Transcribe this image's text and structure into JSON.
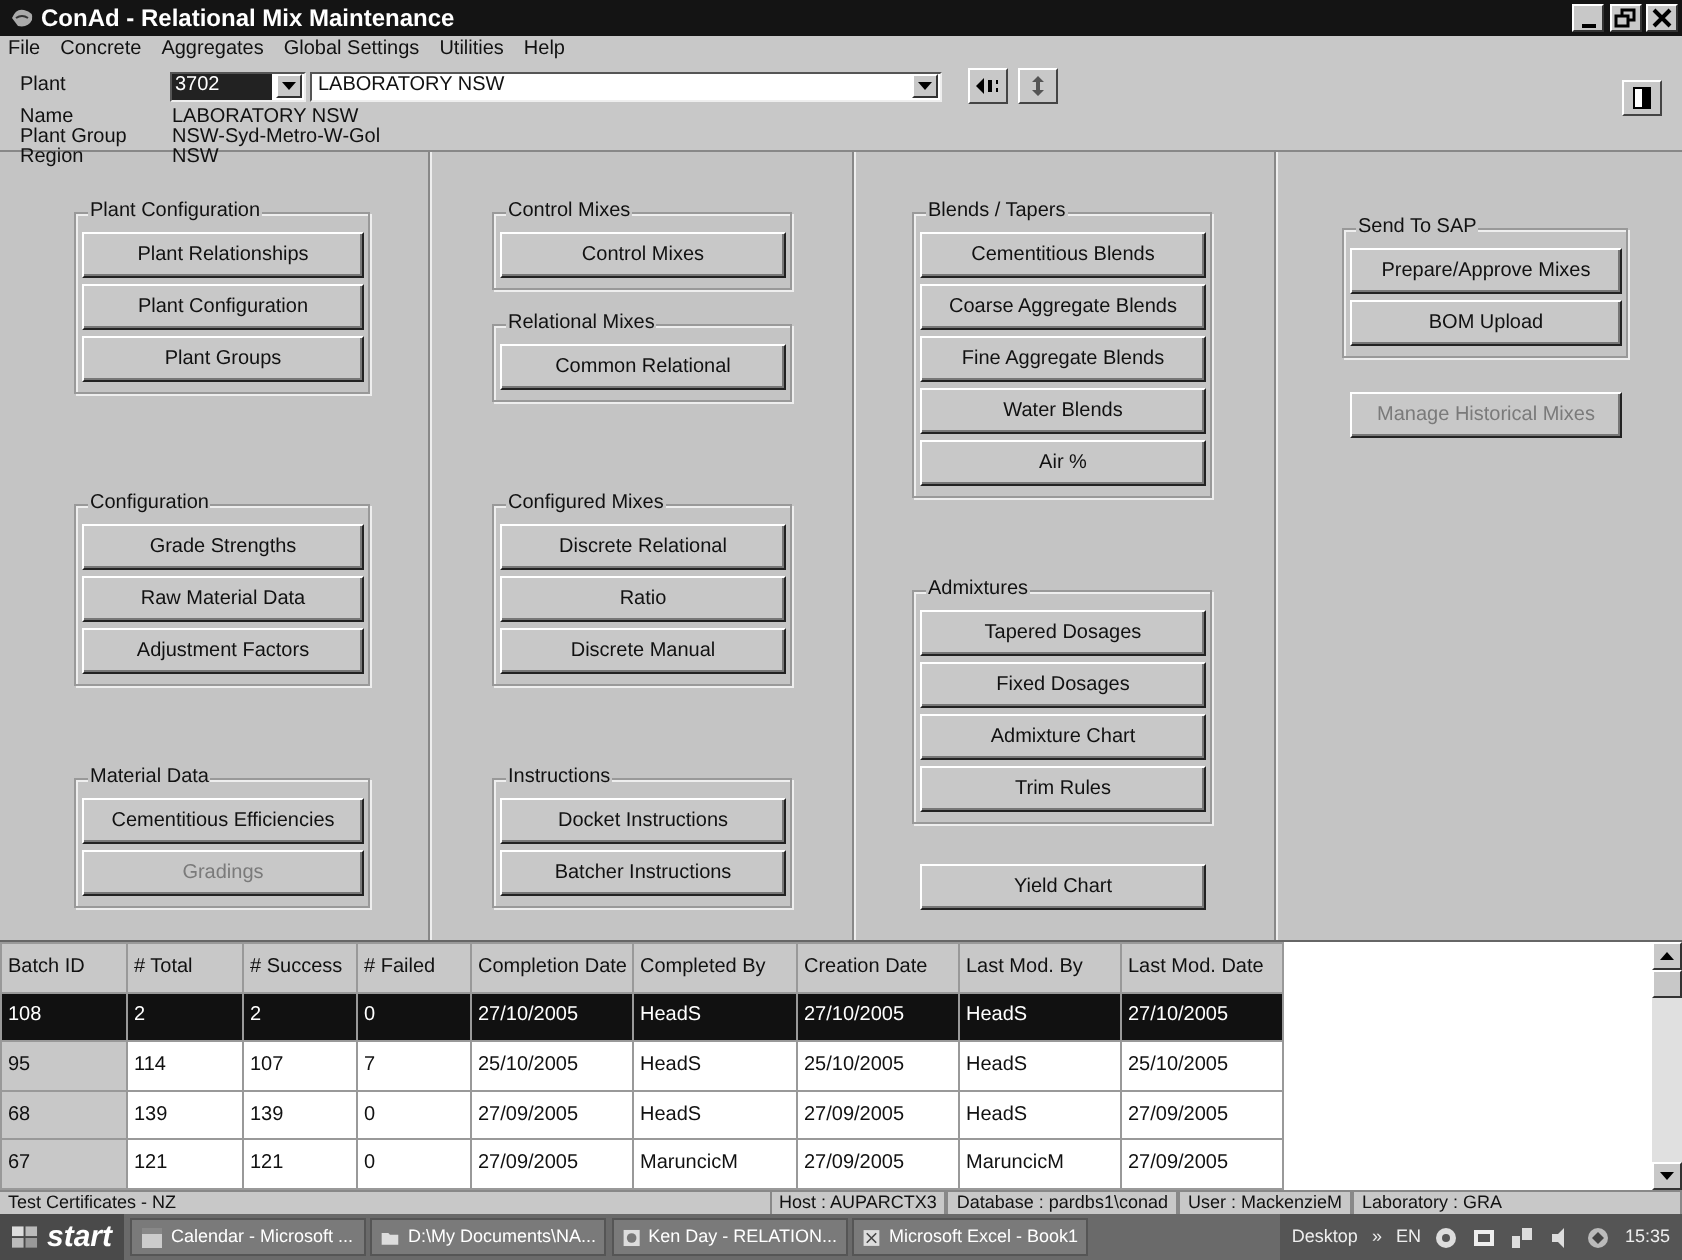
{
  "window": {
    "title": "ConAd - Relational Mix Maintenance"
  },
  "menu": [
    "File",
    "Concrete",
    "Aggregates",
    "Global Settings",
    "Utilities",
    "Help"
  ],
  "plant": {
    "label": "Plant",
    "code": "3702",
    "name_select": "LABORATORY NSW",
    "info": [
      {
        "label": "Name",
        "value": "LABORATORY NSW"
      },
      {
        "label": "Plant Group",
        "value": "NSW-Syd-Metro-W-Gol"
      },
      {
        "label": "Region",
        "value": "NSW"
      }
    ]
  },
  "columns": [
    {
      "items": [
        {
          "kind": "group",
          "title": "Plant Configuration",
          "buttons": [
            {
              "label": "Plant Relationships",
              "disabled": false
            },
            {
              "label": "Plant Configuration",
              "disabled": false
            },
            {
              "label": "Plant Groups",
              "disabled": false
            }
          ]
        },
        {
          "kind": "group",
          "title": "Configuration",
          "buttons": [
            {
              "label": "Grade Strengths",
              "disabled": false
            },
            {
              "label": "Raw Material Data",
              "disabled": false
            },
            {
              "label": "Adjustment Factors",
              "disabled": false
            }
          ]
        },
        {
          "kind": "group",
          "title": "Material Data",
          "buttons": [
            {
              "label": "Cementitious Efficiencies",
              "disabled": false
            },
            {
              "label": "Gradings",
              "disabled": true
            }
          ]
        }
      ]
    },
    {
      "items": [
        {
          "kind": "group",
          "title": "Control Mixes",
          "buttons": [
            {
              "label": "Control Mixes",
              "disabled": false
            }
          ]
        },
        {
          "kind": "group",
          "title": "Relational Mixes",
          "buttons": [
            {
              "label": "Common Relational",
              "disabled": false
            }
          ]
        },
        {
          "kind": "group",
          "title": "Configured Mixes",
          "buttons": [
            {
              "label": "Discrete Relational",
              "disabled": false
            },
            {
              "label": "Ratio",
              "disabled": false
            },
            {
              "label": "Discrete Manual",
              "disabled": false
            }
          ]
        },
        {
          "kind": "group",
          "title": "Instructions",
          "buttons": [
            {
              "label": "Docket Instructions",
              "disabled": false
            },
            {
              "label": "Batcher Instructions",
              "disabled": false
            }
          ]
        }
      ]
    },
    {
      "items": [
        {
          "kind": "group",
          "title": "Blends / Tapers",
          "buttons": [
            {
              "label": "Cementitious Blends",
              "disabled": false
            },
            {
              "label": "Coarse Aggregate Blends",
              "disabled": false
            },
            {
              "label": "Fine Aggregate Blends",
              "disabled": false
            },
            {
              "label": "Water Blends",
              "disabled": false
            },
            {
              "label": "Air %",
              "disabled": false
            }
          ]
        },
        {
          "kind": "group",
          "title": "Admixtures",
          "buttons": [
            {
              "label": "Tapered Dosages",
              "disabled": false
            },
            {
              "label": "Fixed Dosages",
              "disabled": false
            },
            {
              "label": "Admixture Chart",
              "disabled": false
            },
            {
              "label": "Trim Rules",
              "disabled": false
            }
          ]
        },
        {
          "kind": "button",
          "label": "Yield Chart",
          "disabled": false
        }
      ]
    },
    {
      "items": [
        {
          "kind": "group",
          "title": "Send To SAP",
          "buttons": [
            {
              "label": "Prepare/Approve Mixes",
              "disabled": false
            },
            {
              "label": "BOM Upload",
              "disabled": false
            }
          ]
        },
        {
          "kind": "button",
          "label": "Manage Historical Mixes",
          "disabled": true
        }
      ]
    }
  ],
  "table": {
    "columns": [
      "Batch ID",
      "# Total",
      "# Success",
      "# Failed",
      "Completion Date",
      "Completed By",
      "Creation Date",
      "Last Mod. By",
      "Last Mod. Date"
    ],
    "rows": [
      {
        "selected": true,
        "cells": [
          "108",
          "2",
          "2",
          "0",
          "27/10/2005",
          "HeadS",
          "27/10/2005",
          "HeadS",
          "27/10/2005"
        ]
      },
      {
        "selected": false,
        "cells": [
          "95",
          "114",
          "107",
          "7",
          "25/10/2005",
          "HeadS",
          "25/10/2005",
          "HeadS",
          "25/10/2005"
        ]
      },
      {
        "selected": false,
        "cells": [
          "68",
          "139",
          "139",
          "0",
          "27/09/2005",
          "HeadS",
          "27/09/2005",
          "HeadS",
          "27/09/2005"
        ]
      },
      {
        "selected": false,
        "cells": [
          "67",
          "121",
          "121",
          "0",
          "27/09/2005",
          "MaruncicM",
          "27/09/2005",
          "MaruncicM",
          "27/09/2005"
        ]
      }
    ]
  },
  "status_bar": [
    "Test Certificates - NZ",
    "Host : AUPARCTX3",
    "Database : pardbs1\\conad",
    "User : MackenzieM",
    "Laboratory : GRA"
  ],
  "taskbar": {
    "start": "start",
    "tasks": [
      "Calendar - Microsoft ...",
      "D:\\My Documents\\NA...",
      "Ken Day - RELATION...",
      "Microsoft Excel - Book1"
    ],
    "desktop": "Desktop",
    "chevron": "»",
    "language": "EN",
    "clock": "15:35"
  }
}
